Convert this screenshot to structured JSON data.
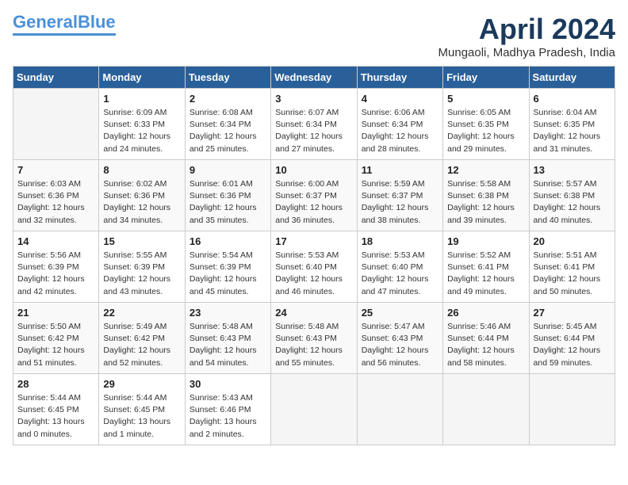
{
  "header": {
    "logo_line1": "General",
    "logo_line2": "Blue",
    "month_title": "April 2024",
    "location": "Mungaoli, Madhya Pradesh, India"
  },
  "days_of_week": [
    "Sunday",
    "Monday",
    "Tuesday",
    "Wednesday",
    "Thursday",
    "Friday",
    "Saturday"
  ],
  "weeks": [
    [
      {
        "day": "",
        "content": ""
      },
      {
        "day": "1",
        "content": "Sunrise: 6:09 AM\nSunset: 6:33 PM\nDaylight: 12 hours\nand 24 minutes."
      },
      {
        "day": "2",
        "content": "Sunrise: 6:08 AM\nSunset: 6:34 PM\nDaylight: 12 hours\nand 25 minutes."
      },
      {
        "day": "3",
        "content": "Sunrise: 6:07 AM\nSunset: 6:34 PM\nDaylight: 12 hours\nand 27 minutes."
      },
      {
        "day": "4",
        "content": "Sunrise: 6:06 AM\nSunset: 6:34 PM\nDaylight: 12 hours\nand 28 minutes."
      },
      {
        "day": "5",
        "content": "Sunrise: 6:05 AM\nSunset: 6:35 PM\nDaylight: 12 hours\nand 29 minutes."
      },
      {
        "day": "6",
        "content": "Sunrise: 6:04 AM\nSunset: 6:35 PM\nDaylight: 12 hours\nand 31 minutes."
      }
    ],
    [
      {
        "day": "7",
        "content": "Sunrise: 6:03 AM\nSunset: 6:36 PM\nDaylight: 12 hours\nand 32 minutes."
      },
      {
        "day": "8",
        "content": "Sunrise: 6:02 AM\nSunset: 6:36 PM\nDaylight: 12 hours\nand 34 minutes."
      },
      {
        "day": "9",
        "content": "Sunrise: 6:01 AM\nSunset: 6:36 PM\nDaylight: 12 hours\nand 35 minutes."
      },
      {
        "day": "10",
        "content": "Sunrise: 6:00 AM\nSunset: 6:37 PM\nDaylight: 12 hours\nand 36 minutes."
      },
      {
        "day": "11",
        "content": "Sunrise: 5:59 AM\nSunset: 6:37 PM\nDaylight: 12 hours\nand 38 minutes."
      },
      {
        "day": "12",
        "content": "Sunrise: 5:58 AM\nSunset: 6:38 PM\nDaylight: 12 hours\nand 39 minutes."
      },
      {
        "day": "13",
        "content": "Sunrise: 5:57 AM\nSunset: 6:38 PM\nDaylight: 12 hours\nand 40 minutes."
      }
    ],
    [
      {
        "day": "14",
        "content": "Sunrise: 5:56 AM\nSunset: 6:39 PM\nDaylight: 12 hours\nand 42 minutes."
      },
      {
        "day": "15",
        "content": "Sunrise: 5:55 AM\nSunset: 6:39 PM\nDaylight: 12 hours\nand 43 minutes."
      },
      {
        "day": "16",
        "content": "Sunrise: 5:54 AM\nSunset: 6:39 PM\nDaylight: 12 hours\nand 45 minutes."
      },
      {
        "day": "17",
        "content": "Sunrise: 5:53 AM\nSunset: 6:40 PM\nDaylight: 12 hours\nand 46 minutes."
      },
      {
        "day": "18",
        "content": "Sunrise: 5:53 AM\nSunset: 6:40 PM\nDaylight: 12 hours\nand 47 minutes."
      },
      {
        "day": "19",
        "content": "Sunrise: 5:52 AM\nSunset: 6:41 PM\nDaylight: 12 hours\nand 49 minutes."
      },
      {
        "day": "20",
        "content": "Sunrise: 5:51 AM\nSunset: 6:41 PM\nDaylight: 12 hours\nand 50 minutes."
      }
    ],
    [
      {
        "day": "21",
        "content": "Sunrise: 5:50 AM\nSunset: 6:42 PM\nDaylight: 12 hours\nand 51 minutes."
      },
      {
        "day": "22",
        "content": "Sunrise: 5:49 AM\nSunset: 6:42 PM\nDaylight: 12 hours\nand 52 minutes."
      },
      {
        "day": "23",
        "content": "Sunrise: 5:48 AM\nSunset: 6:43 PM\nDaylight: 12 hours\nand 54 minutes."
      },
      {
        "day": "24",
        "content": "Sunrise: 5:48 AM\nSunset: 6:43 PM\nDaylight: 12 hours\nand 55 minutes."
      },
      {
        "day": "25",
        "content": "Sunrise: 5:47 AM\nSunset: 6:43 PM\nDaylight: 12 hours\nand 56 minutes."
      },
      {
        "day": "26",
        "content": "Sunrise: 5:46 AM\nSunset: 6:44 PM\nDaylight: 12 hours\nand 58 minutes."
      },
      {
        "day": "27",
        "content": "Sunrise: 5:45 AM\nSunset: 6:44 PM\nDaylight: 12 hours\nand 59 minutes."
      }
    ],
    [
      {
        "day": "28",
        "content": "Sunrise: 5:44 AM\nSunset: 6:45 PM\nDaylight: 13 hours\nand 0 minutes."
      },
      {
        "day": "29",
        "content": "Sunrise: 5:44 AM\nSunset: 6:45 PM\nDaylight: 13 hours\nand 1 minute."
      },
      {
        "day": "30",
        "content": "Sunrise: 5:43 AM\nSunset: 6:46 PM\nDaylight: 13 hours\nand 2 minutes."
      },
      {
        "day": "",
        "content": ""
      },
      {
        "day": "",
        "content": ""
      },
      {
        "day": "",
        "content": ""
      },
      {
        "day": "",
        "content": ""
      }
    ]
  ]
}
